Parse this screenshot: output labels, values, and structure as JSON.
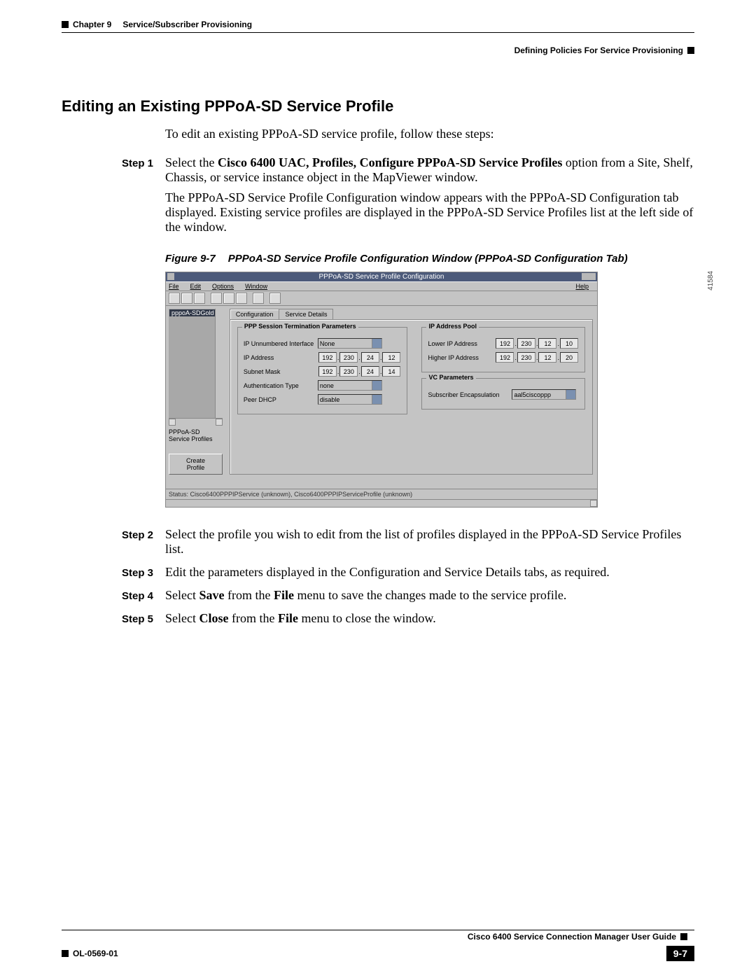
{
  "header": {
    "chapter": "Chapter 9",
    "chapter_title": "Service/Subscriber Provisioning",
    "section": "Defining Policies For Service Provisioning"
  },
  "title": "Editing an Existing PPPoA-SD Service Profile",
  "intro": "To edit an existing PPPoA-SD service profile, follow these steps:",
  "steps": {
    "s1": {
      "label": "Step 1",
      "p1a": "Select the ",
      "p1b": "Cisco 6400 UAC, Profiles, Configure PPPoA-SD Service Profiles",
      "p1c": " option from a Site, Shelf, Chassis, or service instance object in the MapViewer window.",
      "p2": "The PPPoA-SD Service Profile Configuration window appears with the PPPoA-SD Configuration tab displayed. Existing service profiles are displayed in the PPPoA-SD Service Profiles list at the left side of the window."
    },
    "s2": {
      "label": "Step 2",
      "body": "Select the profile you wish to edit from the list of profiles displayed in the PPPoA-SD Service Profiles list."
    },
    "s3": {
      "label": "Step 3",
      "body": "Edit the parameters displayed in the Configuration and Service Details tabs, as required."
    },
    "s4": {
      "label": "Step 4",
      "a": "Select ",
      "b": "Save",
      "c": " from the ",
      "d": "File",
      "e": " menu to save the changes made to the service profile."
    },
    "s5": {
      "label": "Step 5",
      "a": "Select ",
      "b": "Close",
      "c": " from the ",
      "d": "File",
      "e": " menu to close the window."
    }
  },
  "figure": {
    "num": "Figure 9-7",
    "title": "PPPoA-SD Service Profile Configuration Window (PPPoA-SD Configuration Tab)",
    "side_num": "41584"
  },
  "cfgwin": {
    "title": "PPPoA-SD Service Profile Configuration",
    "menu": {
      "file": "File",
      "edit": "Edit",
      "options": "Options",
      "window": "Window",
      "help": "Help"
    },
    "tabs": {
      "config": "Configuration",
      "details": "Service Details"
    },
    "left": {
      "item": "pppoA-SDGold",
      "label": "PPPoA-SD Service Profiles",
      "create": "Create Profile"
    },
    "ppp": {
      "legend": "PPP Session Termination Parameters",
      "ip_unnum_lbl": "IP Unnumbered Interface",
      "ip_unnum_val": "None",
      "ip_addr_lbl": "IP Address",
      "ip_addr": {
        "a": "192",
        "b": "230",
        "c": "24",
        "d": "12"
      },
      "subnet_lbl": "Subnet Mask",
      "subnet": {
        "a": "192",
        "b": "230",
        "c": "24",
        "d": "14"
      },
      "auth_lbl": "Authentication Type",
      "auth_val": "none",
      "dhcp_lbl": "Peer DHCP",
      "dhcp_val": "disable"
    },
    "pool": {
      "legend": "IP Address Pool",
      "low_lbl": "Lower IP Address",
      "low": {
        "a": "192",
        "b": "230",
        "c": "12",
        "d": "10"
      },
      "high_lbl": "Higher IP Address",
      "high": {
        "a": "192",
        "b": "230",
        "c": "12",
        "d": "20"
      }
    },
    "vc": {
      "legend": "VC Parameters",
      "encap_lbl": "Subscriber Encapsulation",
      "encap_val": "aal5ciscoppp"
    },
    "status": "Status: Cisco6400PPPIPService (unknown), Cisco6400PPPIPServiceProfile (unknown)"
  },
  "footer": {
    "guide": "Cisco 6400 Service Connection Manager User Guide",
    "docnum": "OL-0569-01",
    "pagenum": "9-7"
  }
}
